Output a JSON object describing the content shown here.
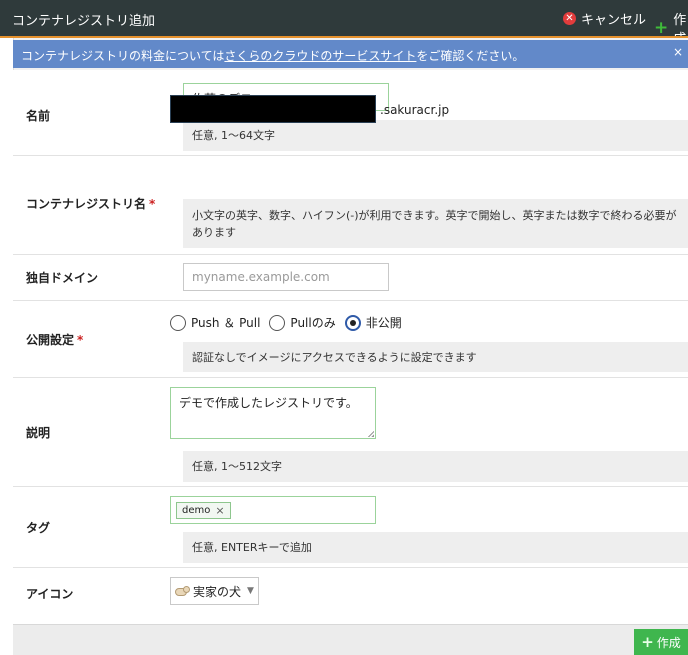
{
  "header": {
    "title": "コンテナレジストリ追加",
    "cancel_label": "キャンセル",
    "create_label": "作成"
  },
  "notice": {
    "text_before": "コンテナレジストリの料金については",
    "link_text": "さくらのクラウドのサービスサイト",
    "text_after": "をご確認ください。",
    "close": "×"
  },
  "form": {
    "name": {
      "label": "名前",
      "value": "佐藤のデモ",
      "help": "任意, 1〜64文字"
    },
    "registry_name": {
      "label": "コンテナレジストリ名",
      "required_mark": "*",
      "suffix": ".sakuracr.jp",
      "help": "小文字の英字、数字、ハイフン(-)が利用できます。英字で開始し、英字または数字で終わる必要があります"
    },
    "custom_domain": {
      "label": "独自ドメイン",
      "placeholder": "myname.example.com"
    },
    "visibility": {
      "label": "公開設定",
      "required_mark": "*",
      "options": [
        "Push ＆ Pull",
        "Pullのみ",
        "非公開"
      ],
      "selected": "非公開",
      "help": "認証なしでイメージにアクセスできるように設定できます"
    },
    "description": {
      "label": "説明",
      "value": "デモで作成したレジストリです。",
      "help": "任意, 1〜512文字"
    },
    "tags": {
      "label": "タグ",
      "items": [
        "demo"
      ],
      "remove": "×",
      "help": "任意, ENTERキーで追加"
    },
    "icon": {
      "label": "アイコン",
      "value": "実家の犬",
      "caret": "▼"
    }
  },
  "footer": {
    "create_label": "作成"
  },
  "colors": {
    "titlebar": "#2f3a3b",
    "accent": "#e5912d",
    "notice": "#6289c9",
    "create_button": "#3fb64e",
    "required": "#cc2222"
  }
}
